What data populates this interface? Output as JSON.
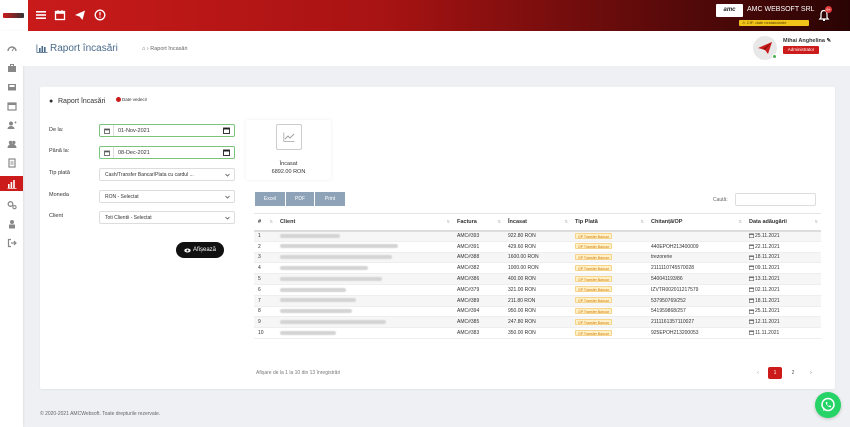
{
  "topbar": {
    "company_badge": "amc",
    "company_name": "AMC WEBSOFT SRL",
    "notification_count": "9+",
    "warning_text": "⚠ CIF: date nestandarde"
  },
  "header": {
    "page_title": "Raport încasări",
    "breadcrumb": "Raport încasări",
    "user_name": "Mihai Anghelina",
    "user_role": "Administrator"
  },
  "filters": {
    "title": "Raport încasări",
    "subtitle": "Date vedeci!",
    "date_from_label": "De la:",
    "date_from_value": "01-Nov-2021",
    "date_to_label": "Până la:",
    "date_to_value": "08-Dec-2021",
    "payment_type_label": "Tip plată",
    "payment_type_value": "Cash/Transfer Bancar/Plata cu cardul ...",
    "currency_label": "Moneda",
    "currency_value": "RON - Selectat",
    "client_label": "Client",
    "client_value": "Toti Clientii - Selectat",
    "show_button": "Afișează"
  },
  "stat": {
    "label": "Încasat",
    "value": "6892.00 RON"
  },
  "export": {
    "excel": "Excel",
    "pdf": "PDF",
    "print": "Print"
  },
  "search": {
    "label": "Caută:"
  },
  "table": {
    "headers": [
      "#",
      "Client",
      "Factura",
      "Încasat",
      "Tip Plată",
      "Chitanță/OP",
      "Data adăugării"
    ],
    "rows": [
      {
        "n": "1",
        "factura": "AMC#393",
        "suma": "922.80 RON",
        "tip": "OP Transfer Bancar",
        "op": "",
        "data": "25.11.2021"
      },
      {
        "n": "2",
        "factura": "AMC#391",
        "suma": "429.60 RON",
        "tip": "OP Transfer Bancar",
        "op": "440EPOH213400009",
        "data": "22.11.2021"
      },
      {
        "n": "3",
        "factura": "AMC#388",
        "suma": "1600.00 RON",
        "tip": "OP Transfer Bancar",
        "op": "trezorerie",
        "data": "18.11.2021"
      },
      {
        "n": "4",
        "factura": "AMC#382",
        "suma": "1000.00 RON",
        "tip": "OP Transfer Bancar",
        "op": "2111110745570028",
        "data": "09.11.2021"
      },
      {
        "n": "5",
        "factura": "AMC#386",
        "suma": "400.00 RON",
        "tip": "OP Transfer Bancar",
        "op": "540041193/86",
        "data": "13.11.2021"
      },
      {
        "n": "6",
        "factura": "AMC#379",
        "suma": "321.00 RON",
        "tip": "OP Transfer Bancar",
        "op": "IZVTR002011217579",
        "data": "02.11.2021"
      },
      {
        "n": "7",
        "factura": "AMC#389",
        "suma": "211.80 RON",
        "tip": "OP Transfer Bancar",
        "op": "537950769/252",
        "data": "18.11.2021"
      },
      {
        "n": "8",
        "factura": "AMC#394",
        "suma": "950.00 RON",
        "tip": "OP Transfer Bancar",
        "op": "541959868/257",
        "data": "25.11.2021"
      },
      {
        "n": "9",
        "factura": "AMC#385",
        "suma": "247.80 RON",
        "tip": "OP Transfer Bancar",
        "op": "2111161357110027",
        "data": "12.11.2021"
      },
      {
        "n": "10",
        "factura": "AMC#383",
        "suma": "350.00 RON",
        "tip": "OP Transfer Bancar",
        "op": "925EPOH213200053",
        "data": "11.11.2021"
      }
    ],
    "info": "Afișare de la 1 la 10 din 13 înregistrări"
  },
  "pagination": {
    "prev": "‹",
    "page1": "1",
    "page2": "2",
    "next": "›"
  },
  "footer": {
    "copyright": "© 2020-2021 AMCWebsoft. Toate drepturile rezervate."
  },
  "colors": {
    "brand_red": "#cc1b1b",
    "badge_orange": "#d07a00",
    "export_button": "#8fa3b8",
    "whatsapp_green": "#25d366"
  },
  "icons": [
    "menu-icon",
    "calendar-icon",
    "telegram-icon",
    "help-icon",
    "bell-icon",
    "chart-icon",
    "home-icon",
    "users-icon",
    "whatsapp-icon",
    "eye-icon",
    "sort-icon"
  ]
}
